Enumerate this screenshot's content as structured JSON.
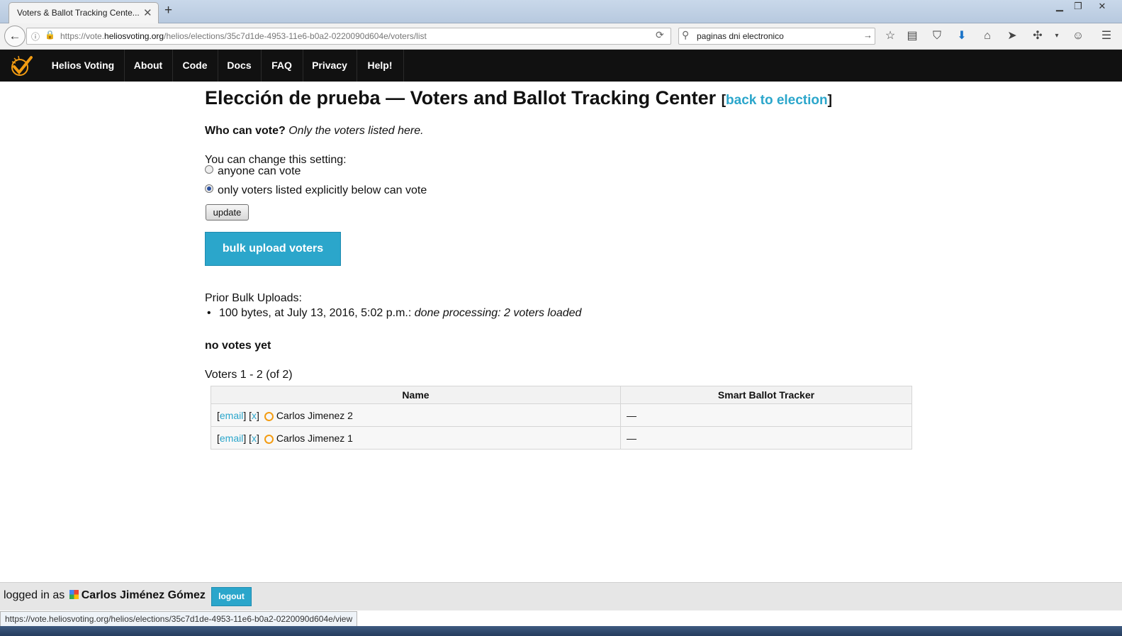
{
  "browser": {
    "tab_title": "Voters & Ballot Tracking Cente...",
    "tab_close": "✕",
    "new_tab": "+",
    "url_prefix": "https://vote.",
    "url_domain": "heliosvoting.org",
    "url_path": "/helios/elections/35c7d1de-4953-11e6-b0a2-0220090d604e/voters/list",
    "search_text": "paginas dni electronico"
  },
  "site_nav": {
    "items": [
      "Helios Voting",
      "About",
      "Code",
      "Docs",
      "FAQ",
      "Privacy",
      "Help!"
    ]
  },
  "page": {
    "title": "Elección de prueba — Voters and Ballot Tracking Center",
    "bracket_open": "[",
    "back_link": "back to election",
    "bracket_close": "]",
    "who_can_vote_label": "Who can vote?",
    "who_can_vote_value": "Only the voters listed here.",
    "change_setting": "You can change this setting:",
    "radio_anyone": "anyone can vote",
    "radio_listed": "only voters listed explicitly below can vote",
    "update_button": "update",
    "bulk_upload_button": "bulk upload voters",
    "prior_uploads_label": "Prior Bulk Uploads:",
    "prior_upload_item": "100 bytes, at July 13, 2016, 5:02 p.m.:",
    "prior_upload_status": "done processing: 2 voters loaded",
    "no_votes": "no votes yet",
    "voter_count": "Voters 1 - 2 (of 2)"
  },
  "voters_table": {
    "headers": [
      "Name",
      "Smart Ballot Tracker"
    ],
    "email_link": "email",
    "remove_link": "x",
    "rows": [
      {
        "name": "Carlos Jimenez 2",
        "tracker": "—"
      },
      {
        "name": "Carlos Jimenez 1",
        "tracker": "—"
      }
    ]
  },
  "footer": {
    "logged_in_as": "logged in as",
    "user_name": "Carlos Jiménez Gómez",
    "logout_button": "logout"
  },
  "status_url": "https://vote.heliosvoting.org/helios/elections/35c7d1de-4953-11e6-b0a2-0220090d604e/view",
  "colors": {
    "accent": "#2ba6cb",
    "navbar": "#111111",
    "ring": "#f39c12"
  }
}
